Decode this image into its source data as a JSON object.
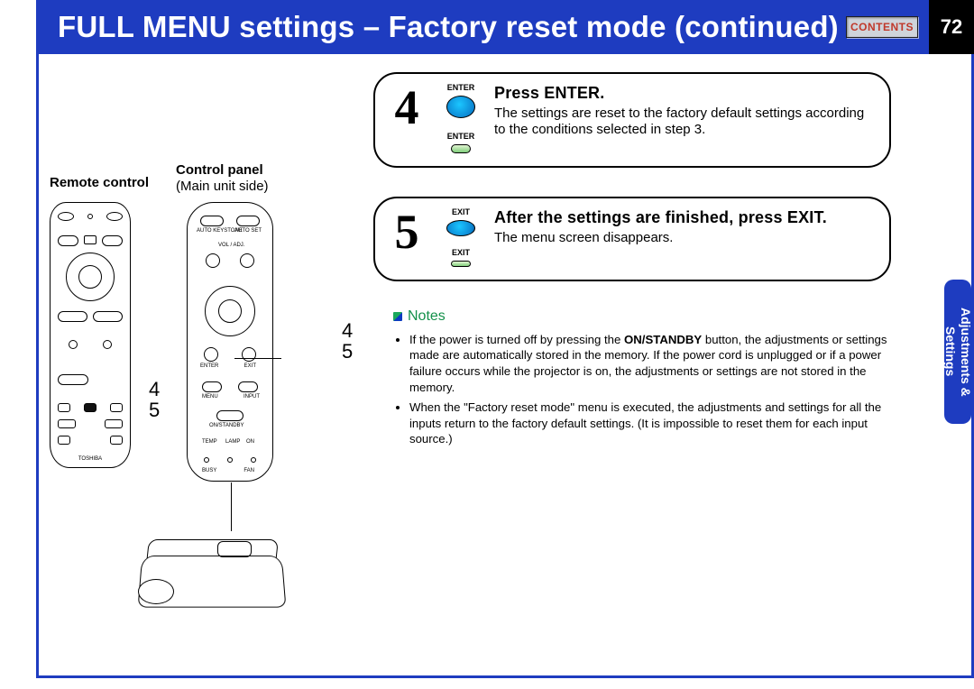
{
  "header": {
    "title": "FULL MENU settings – Factory reset mode (continued)",
    "contents_label": "CONTENTS",
    "page_number": "72"
  },
  "side_tab": {
    "line1": "Adjustments &",
    "line2": "Settings"
  },
  "left": {
    "remote_label": "Remote control",
    "cpanel_label_1": "Control panel",
    "cpanel_label_2": "(Main unit side)",
    "remote_callouts": "4\n5",
    "cpanel_callouts": "4\n5",
    "remote_brand": "TOSHIBA",
    "cpanel_small_labels": {
      "auto_keystone": "AUTO KEYSTONE",
      "auto_set": "AUTO SET",
      "vol_adj": "VOL / ADJ.",
      "enter": "ENTER",
      "exit": "EXIT",
      "menu": "MENU",
      "input": "INPUT",
      "on_standby": "ON/STANDBY",
      "temp": "TEMP",
      "lamp": "LAMP",
      "on": "ON",
      "busy": "BUSY",
      "fan": "FAN"
    }
  },
  "steps": {
    "s4": {
      "num": "4",
      "btn_cap_top": "ENTER",
      "btn_cap_bottom": "ENTER",
      "headline": "Press ENTER.",
      "body": "The settings are reset to the factory default settings according to the conditions selected in step 3."
    },
    "s5": {
      "num": "5",
      "btn_cap_top": "EXIT",
      "btn_cap_bottom": "EXIT",
      "headline": "After the settings are finished, press EXIT.",
      "body": "The menu screen disappears."
    }
  },
  "notes": {
    "title": "Notes",
    "bullets": [
      "If the power is turned off by pressing the ON/STANDBY button, the adjustments or settings made are automatically stored in the memory. If the power cord is unplugged or if a power failure occurs while the projector is on, the adjustments or settings are not stored in the memory.",
      "When the \"Factory reset mode\" menu is executed, the adjustments and settings for all the inputs return to the factory default settings.  (It is impossible to reset them for each input source.)"
    ],
    "bold_in_bullet0": "ON/STANDBY"
  }
}
